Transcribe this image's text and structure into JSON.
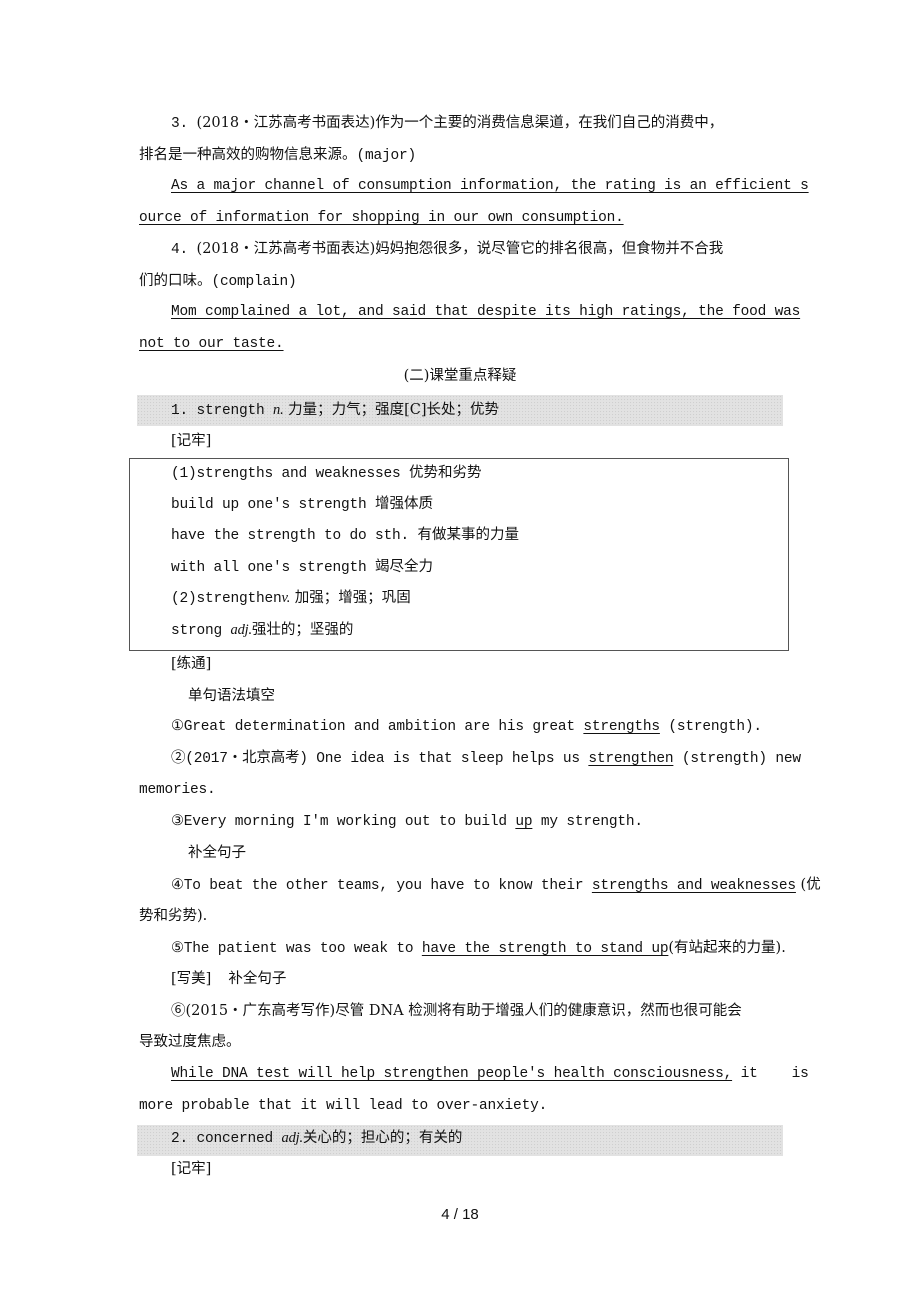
{
  "document": {
    "items_top": [
      {
        "prompt_number": "3.",
        "prompt_source": "(2018・江苏高考书面表达)",
        "prompt_text_line1": "作为一个主要的消费信息渠道，在我们自己的消费中，",
        "prompt_text_line2": "排名是一种高效的购物信息来源。",
        "keyword": "(major)",
        "answer_line1": "As a major channel of consumption information, the rating is an efficient s",
        "answer_line2": "ource of information for shopping in our own consumption."
      },
      {
        "prompt_number": "4.",
        "prompt_source": "(2018・江苏高考书面表达)",
        "prompt_text_line1": "妈妈抱怨很多，说尽管它的排名很高，但食物并不合我",
        "prompt_text_line2": "们的口味。",
        "keyword": "(complain)",
        "answer_line1": "Mom complained a lot, and said that despite its high ratings, the food was ",
        "answer_line2": "not to our taste."
      }
    ],
    "section_title": "(二)课堂重点释疑",
    "entries": [
      {
        "heading_prefix": "1. strength ",
        "heading_pos": "n.",
        "heading_meaning": " 力量；力气；强度[C]长处；优势",
        "memorize_label": "[记牢]",
        "box_lines": [
          {
            "en": "(1)strengths and weaknesses ",
            "cn": "优势和劣势"
          },
          {
            "en": "build up one's strength  ",
            "cn": "增强体质"
          },
          {
            "en": "have the strength to do sth.  ",
            "cn": "有做某事的力量"
          },
          {
            "en": "with all one's strength  ",
            "cn": "竭尽全力"
          },
          {
            "en": "(2)strengthen",
            "pos": "v.",
            "cn": "  加强；增强；巩固"
          },
          {
            "en": "strong ",
            "pos": "adj.",
            "cn": "强壮的；坚强的"
          }
        ],
        "practice_label": "[练通]",
        "grammar_fill_label": "单句语法填空",
        "exercises": [
          {
            "before": "①Great determination and ambition are his great ",
            "answer": "strengths",
            "after": " (strength)."
          },
          {
            "before": "②(2017・北京高考) One idea is that sleep helps us ",
            "answer": "strengthen",
            "after": " (strength) new",
            "continuation": "memories."
          },
          {
            "before": "③Every morning I'm working out to build ",
            "answer": "up",
            "after": " my strength."
          }
        ],
        "complete_sentence_label": "补全句子",
        "exercises2": [
          {
            "before": "④To beat the other teams, you have to know their ",
            "answer": "strengths and weaknesses",
            "after": " (优",
            "continuation": "势和劣势)."
          },
          {
            "before": "⑤The patient was too weak to ",
            "answer": "have the strength to stand up",
            "after": "(有站起来的力量)."
          }
        ],
        "write_label": "[写美]",
        "write_sub_label": "补全句子",
        "write_prompt_line1": "⑥(2015・广东高考写作)尽管 DNA 检测将有助于增强人们的健康意识，然而也很可能会",
        "write_prompt_line2": "导致过度焦虑。",
        "write_answer": "While DNA test will help strengthen people's health consciousness,",
        "write_after": " it    is",
        "write_continuation": "more probable that it will lead to over-anxiety."
      },
      {
        "heading_prefix": "2. concerned ",
        "heading_pos": "adj.",
        "heading_meaning": "关心的；担心的；有关的",
        "memorize_label": "[记牢]"
      }
    ],
    "page_indicator": "4 / 18"
  }
}
